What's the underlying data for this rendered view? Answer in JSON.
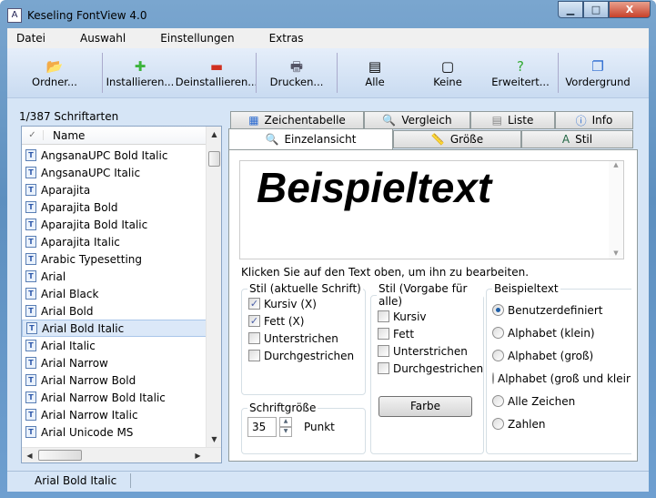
{
  "window": {
    "title": "Keseling FontView 4.0",
    "minimize": "▁",
    "maximize": "□",
    "close": "X"
  },
  "menu": [
    "Datei",
    "Auswahl",
    "Einstellungen",
    "Extras"
  ],
  "toolbar": [
    {
      "label": "Ordner...",
      "icon": "folder-icon",
      "glyph": "📂"
    },
    {
      "label": "Installieren...",
      "icon": "plus-icon",
      "glyph": "✚"
    },
    {
      "label": "Deinstallieren...",
      "icon": "minus-icon",
      "glyph": "▬"
    },
    {
      "label": "Drucken...",
      "icon": "printer-icon",
      "glyph": "🖶"
    },
    {
      "label": "Alle",
      "icon": "select-all-icon",
      "glyph": "▤"
    },
    {
      "label": "Keine",
      "icon": "select-none-icon",
      "glyph": "▢"
    },
    {
      "label": "Erweitert...",
      "icon": "select-advanced-icon",
      "glyph": "?"
    },
    {
      "label": "Vordergrund",
      "icon": "foreground-icon",
      "glyph": "❐"
    }
  ],
  "font_count": "1/387 Schriftarten",
  "list": {
    "header": "Name",
    "items": [
      "AngsanaUPC Bold Italic",
      "AngsanaUPC Italic",
      "Aparajita",
      "Aparajita Bold",
      "Aparajita Bold Italic",
      "Aparajita Italic",
      "Arabic Typesetting",
      "Arial",
      "Arial Black",
      "Arial Bold",
      "Arial Bold Italic",
      "Arial Italic",
      "Arial Narrow",
      "Arial Narrow Bold",
      "Arial Narrow Bold Italic",
      "Arial Narrow Italic",
      "Arial Unicode MS"
    ],
    "selected": "Arial Bold Italic"
  },
  "tabs": {
    "row1": [
      "Zeichentabelle",
      "Vergleich",
      "Liste",
      "Info"
    ],
    "row2": [
      "Einzelansicht",
      "Größe",
      "Stil"
    ],
    "active": "Einzelansicht"
  },
  "preview_text": "Beispieltext",
  "hint": "Klicken Sie auf den Text oben, um ihn zu bearbeiten.",
  "style_current": {
    "title": "Stil (aktuelle Schrift)",
    "items": [
      {
        "label": "Kursiv (X)",
        "checked": true
      },
      {
        "label": "Fett (X)",
        "checked": true
      },
      {
        "label": "Unterstrichen",
        "checked": false
      },
      {
        "label": "Durchgestrichen",
        "checked": false
      }
    ]
  },
  "style_default": {
    "title": "Stil (Vorgabe für alle)",
    "items": [
      {
        "label": "Kursiv",
        "checked": false
      },
      {
        "label": "Fett",
        "checked": false
      },
      {
        "label": "Unterstrichen",
        "checked": false
      },
      {
        "label": "Durchgestrichen",
        "checked": false
      }
    ],
    "color_button": "Farbe"
  },
  "size": {
    "title": "Schriftgröße",
    "value": "35",
    "unit": "Punkt"
  },
  "sample": {
    "title": "Beispieltext",
    "options": [
      "Benutzerdefiniert",
      "Alphabet (klein)",
      "Alphabet (groß)",
      "Alphabet (groß und klein)",
      "Alle Zeichen",
      "Zahlen"
    ],
    "selected": "Benutzerdefiniert"
  },
  "status": "Arial Bold Italic"
}
